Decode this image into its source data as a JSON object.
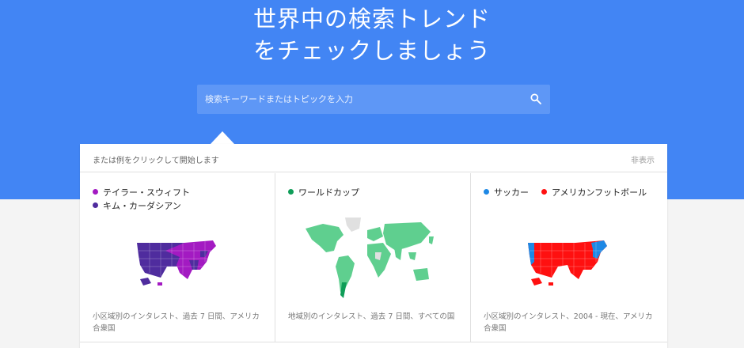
{
  "hero": {
    "headline_line1": "世界中の検索トレンド",
    "headline_line2": "をチェックしましょう",
    "background_color": "#4285f4"
  },
  "search": {
    "placeholder": "検索キーワードまたはトピックを入力",
    "icon": "search-icon"
  },
  "examples": {
    "intro": "または例をクリックして開始します",
    "hide_label": "非表示",
    "cards": [
      {
        "legend": [
          {
            "label": "テイラー・スウィフト",
            "color": "#a31ac2"
          },
          {
            "label": "キム・カーダシアン",
            "color": "#4f2c9e"
          }
        ],
        "description": "小区域別のインタレスト、過去 7 日間、アメリカ合衆国"
      },
      {
        "legend": [
          {
            "label": "ワールドカップ",
            "color": "#0f9d58"
          }
        ],
        "description": "地域別のインタレスト、過去 7 日間、すべての国"
      },
      {
        "legend": [
          {
            "label": "サッカー",
            "color": "#1e88e5"
          },
          {
            "label": "アメリカンフットボール",
            "color": "#ff1010"
          }
        ],
        "description": "小区域別のインタレスト、2004 - 現在、アメリカ合衆国"
      }
    ]
  }
}
